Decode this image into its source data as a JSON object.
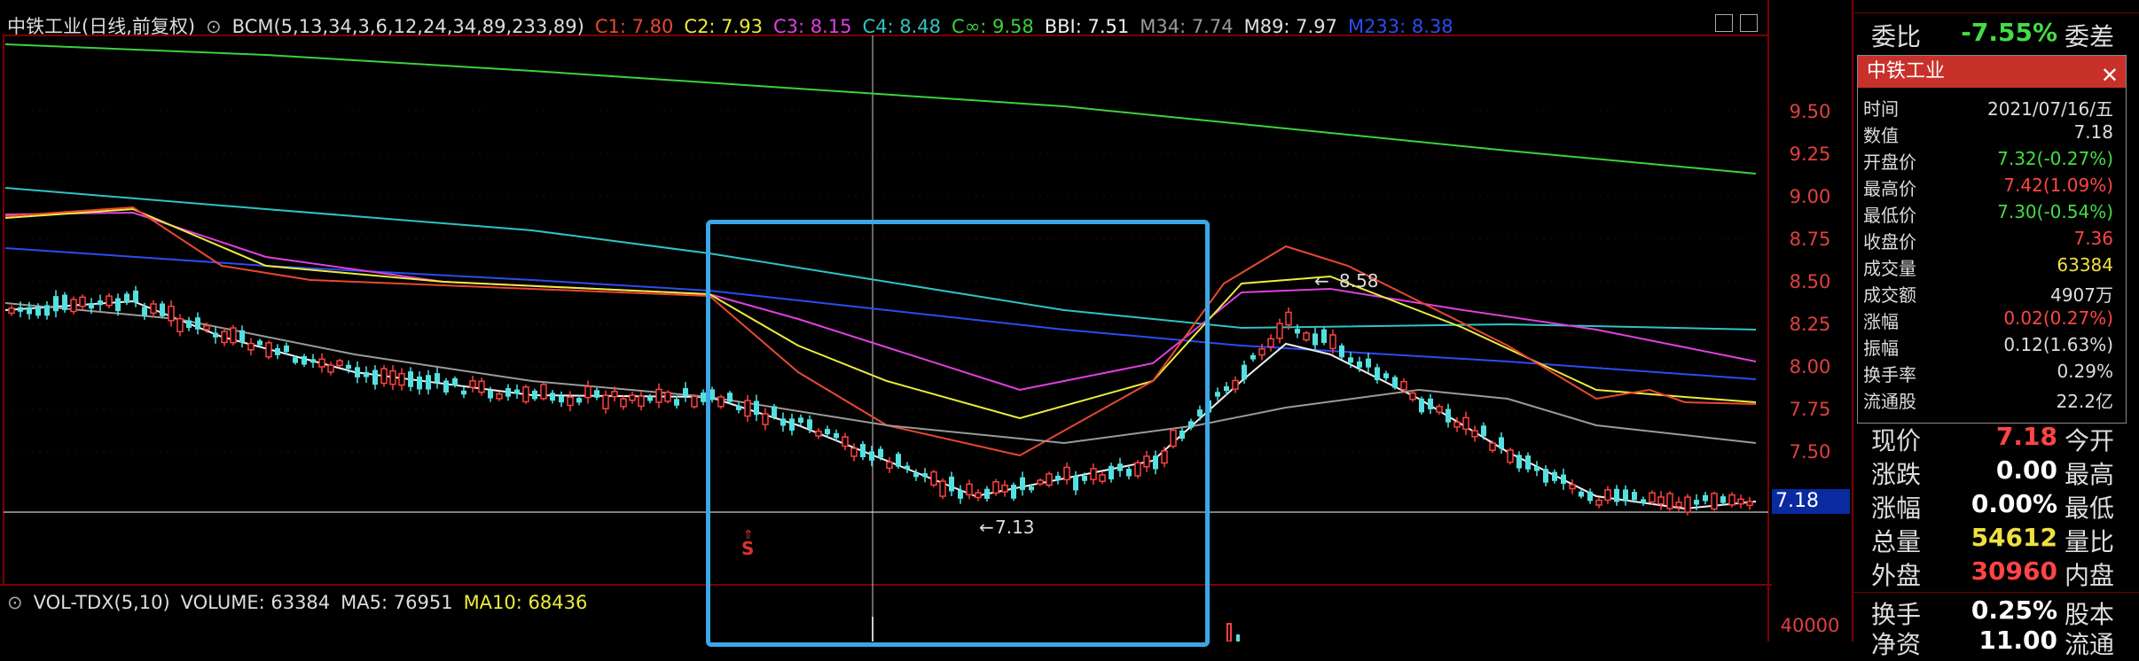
{
  "header": {
    "stock": "中铁工业(日线,前复权)",
    "indicator": "BCM(5,13,34,3,6,12,24,34,89,233,89)",
    "c1": "C1: 7.80",
    "c2": "C2: 7.93",
    "c3": "C3: 8.15",
    "c4": "C4: 8.48",
    "cinf": "C∞: 9.58",
    "bbi": "BBI: 7.51",
    "m34": "M34: 7.74",
    "m89": "M89: 7.97",
    "m233": "M233: 8.38"
  },
  "volume_header": {
    "name": "VOL-TDX(5,10)",
    "volume": "VOLUME: 63384",
    "ma5": "MA5: 76951",
    "ma10": "MA10: 68436"
  },
  "price_axis": [
    "9.50",
    "9.25",
    "9.00",
    "8.75",
    "8.50",
    "8.25",
    "8.00",
    "7.75",
    "7.50"
  ],
  "volume_axis": [
    "40000"
  ],
  "current_price_tag": "7.18",
  "annotations": {
    "high_label": "8.58",
    "low_label": "7.13",
    "signal_label": "S"
  },
  "right_panel": {
    "weibi_label": "委比",
    "weibi_value": "-7.55%",
    "weicha_label": "委差",
    "rows": [
      {
        "label": "现价",
        "value": "7.18",
        "label2": "今开",
        "color": "#ff4444"
      },
      {
        "label": "涨跌",
        "value": "0.00",
        "label2": "最高",
        "color": "#ffffff"
      },
      {
        "label": "涨幅",
        "value": "0.00%",
        "label2": "最低",
        "color": "#ffffff"
      },
      {
        "label": "总量",
        "value": "54612",
        "label2": "量比",
        "color": "#f0e040"
      },
      {
        "label": "外盘",
        "value": "30960",
        "label2": "内盘",
        "color": "#ff4444"
      },
      {
        "label": "换手",
        "value": "0.25%",
        "label2": "股本",
        "color": "#ffffff"
      },
      {
        "label": "净资",
        "value": "11.00",
        "label2": "流通",
        "color": "#ffffff"
      }
    ]
  },
  "popup": {
    "title": "中铁工业",
    "rows": [
      {
        "k": "时间",
        "v": "2021/07/16/五",
        "color": "#dddddd"
      },
      {
        "k": "数值",
        "v": "7.18",
        "color": "#dddddd"
      },
      {
        "k": "开盘价",
        "v": "7.32(-0.27%)",
        "color": "#44dd44"
      },
      {
        "k": "最高价",
        "v": "7.42(1.09%)",
        "color": "#ff4444"
      },
      {
        "k": "最低价",
        "v": "7.30(-0.54%)",
        "color": "#44dd44"
      },
      {
        "k": "收盘价",
        "v": "7.36",
        "color": "#ff4444"
      },
      {
        "k": "成交量",
        "v": "63384",
        "color": "#f0e040"
      },
      {
        "k": "成交额",
        "v": "4907万",
        "color": "#dddddd"
      },
      {
        "k": "涨幅",
        "v": "0.02(0.27%)",
        "color": "#ff4444"
      },
      {
        "k": "振幅",
        "v": "0.12(1.63%)",
        "color": "#dddddd"
      },
      {
        "k": "换手率",
        "v": "0.29%",
        "color": "#dddddd"
      },
      {
        "k": "流通股",
        "v": "22.2亿",
        "color": "#dddddd"
      }
    ]
  },
  "colors": {
    "background": "#000000",
    "axis_red": "#e04040",
    "selection_box": "#3ba7e6",
    "up_candle": "#ff4040",
    "down_candle": "#54e0e0"
  }
}
